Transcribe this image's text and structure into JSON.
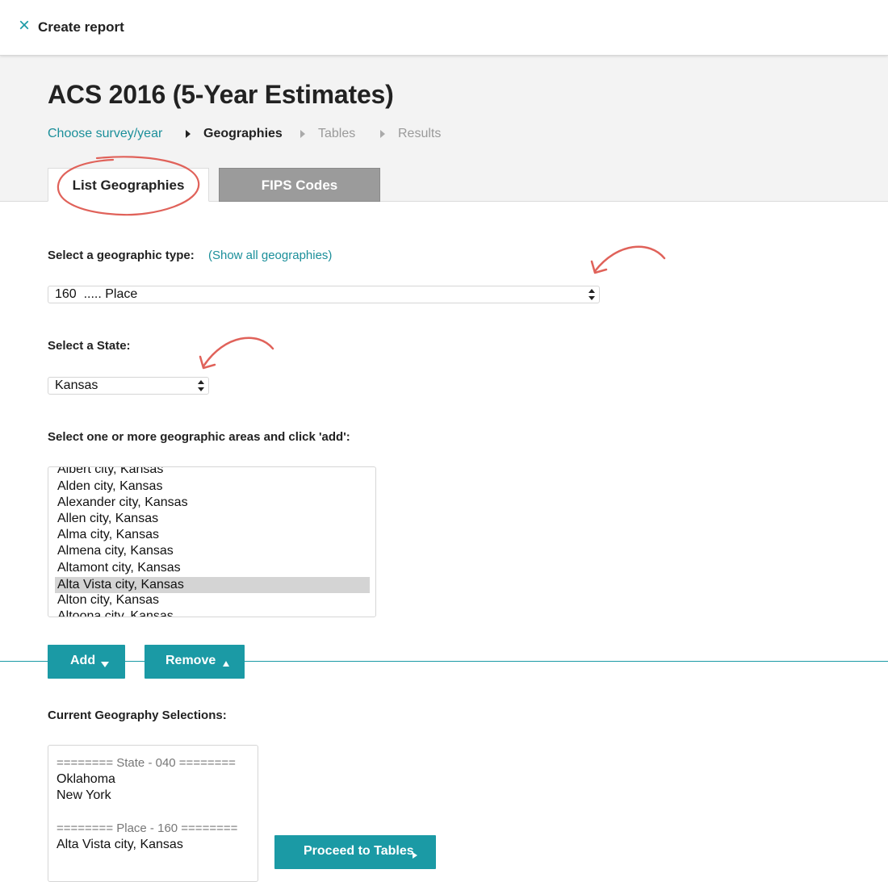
{
  "topbar": {
    "close_icon": "close-icon",
    "title": "Create report"
  },
  "header": {
    "title": "ACS 2016 (5-Year Estimates)",
    "breadcrumb": [
      {
        "label": "Choose survey/year",
        "state": "link"
      },
      {
        "label": "Geographies",
        "state": "current"
      },
      {
        "label": "Tables",
        "state": "disabled"
      },
      {
        "label": "Results",
        "state": "disabled"
      }
    ],
    "tabs": [
      {
        "label": "List Geographies",
        "active": true
      },
      {
        "label": "FIPS Codes",
        "active": false
      }
    ]
  },
  "geo_type": {
    "label": "Select a geographic type:",
    "show_all_link": "(Show all geographies)",
    "selected": "160  ..... Place"
  },
  "state": {
    "label": "Select a State:",
    "selected": "Kansas"
  },
  "areas": {
    "label": "Select one or more geographic areas and click 'add':",
    "items": [
      "Albert city, Kansas",
      "Alden city, Kansas",
      "Alexander city, Kansas",
      "Allen city, Kansas",
      "Alma city, Kansas",
      "Almena city, Kansas",
      "Altamont city, Kansas",
      "Alta Vista city, Kansas",
      "Alton city, Kansas",
      "Altoona city, Kansas"
    ],
    "selected_item": "Alta Vista city, Kansas"
  },
  "buttons": {
    "add": "Add",
    "remove": "Remove",
    "proceed": "Proceed to Tables"
  },
  "current": {
    "label": "Current Geography Selections:",
    "groups": [
      {
        "header": "======== State - 040 ========",
        "items": [
          "Oklahoma",
          "New York"
        ]
      },
      {
        "header": "======== Place - 160 ========",
        "items": [
          "Alta Vista city, Kansas"
        ]
      }
    ]
  },
  "colors": {
    "accent": "#1b9aa5",
    "annotation": "#e0625a",
    "header_bg": "#f3f3f3"
  }
}
